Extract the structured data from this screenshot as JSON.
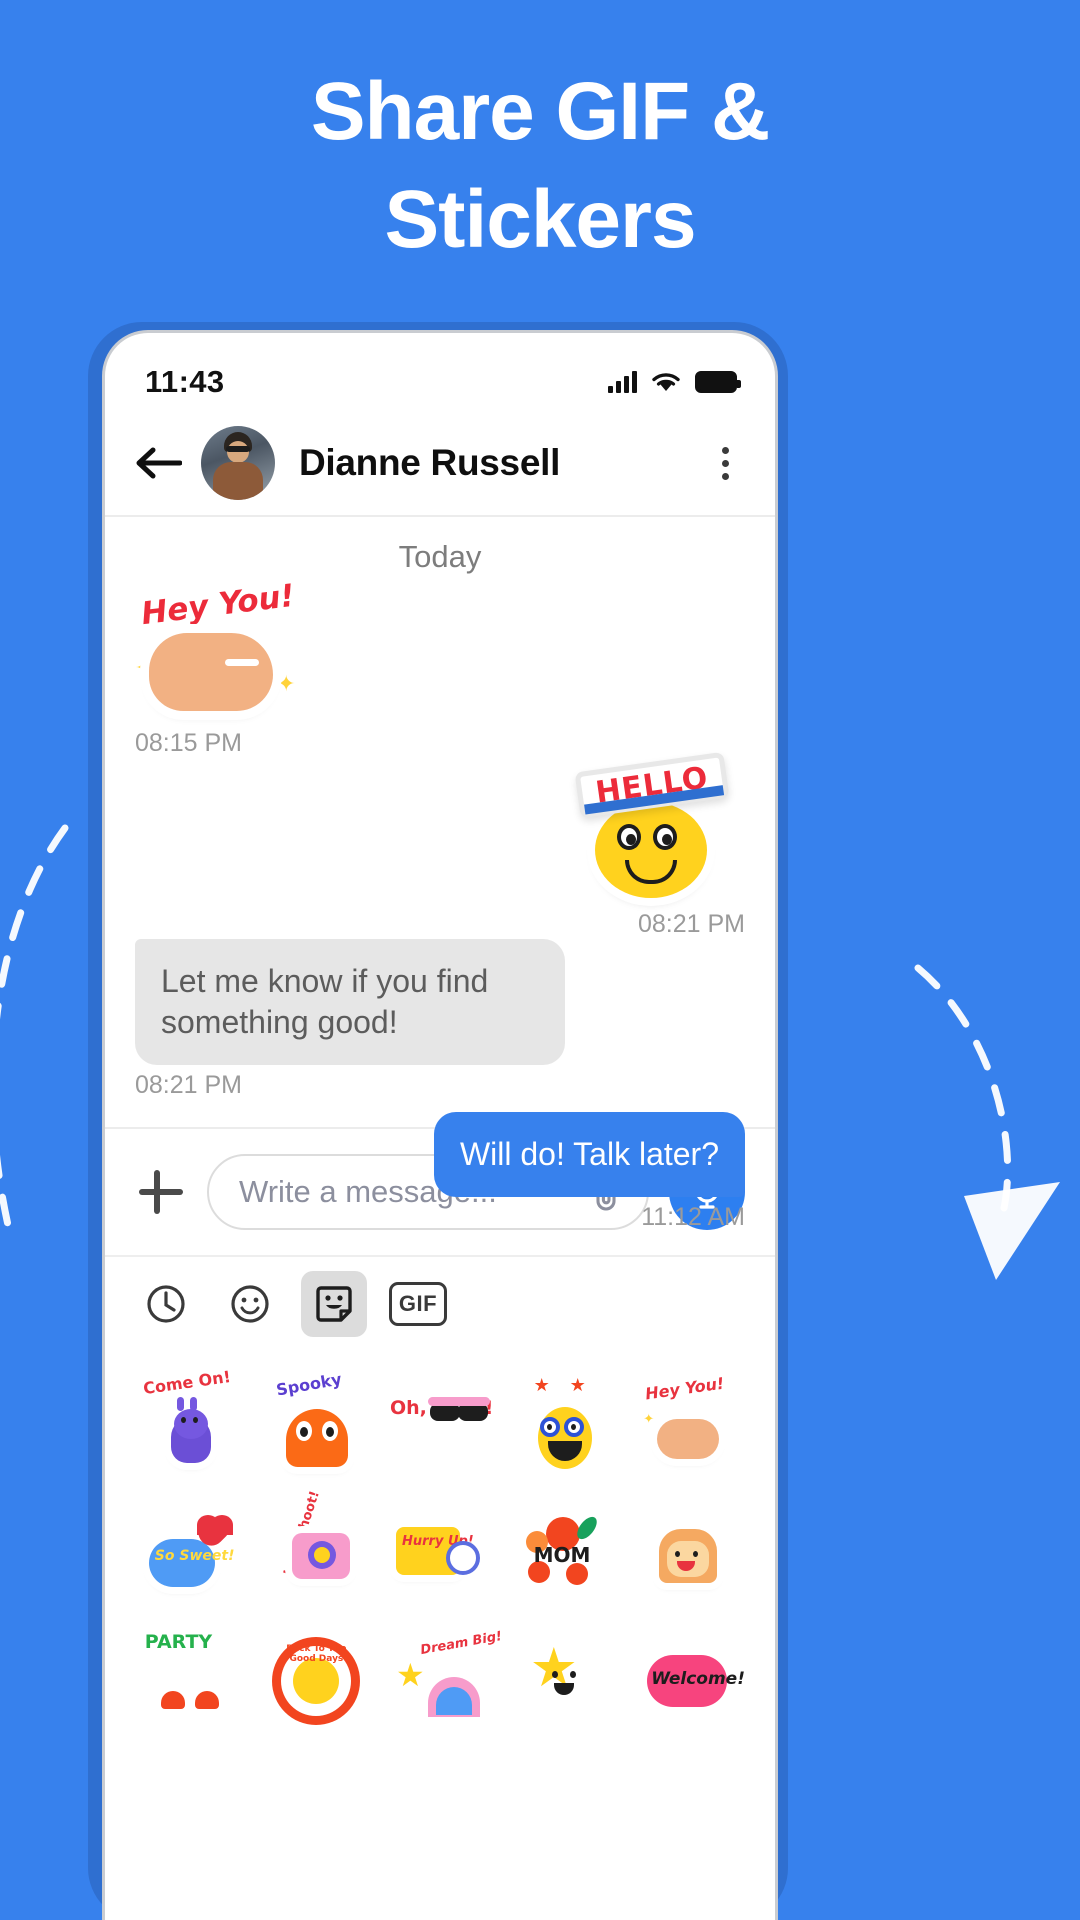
{
  "promo": {
    "headline_line1": "Share GIF &",
    "headline_line2": "Stickers",
    "background_color": "#3781ed"
  },
  "status_bar": {
    "time": "11:43",
    "icons": [
      "signal-icon",
      "wifi-icon",
      "battery-icon"
    ]
  },
  "chat_header": {
    "back_icon": "back-arrow-icon",
    "avatar": "contact-avatar",
    "contact_name": "Dianne Russell",
    "more_icon": "more-vertical-icon"
  },
  "conversation": {
    "day_separator": "Today",
    "messages": [
      {
        "type": "sticker",
        "direction": "in",
        "sticker_label": "Hey You!",
        "time": "08:15 PM"
      },
      {
        "type": "sticker",
        "direction": "out",
        "sticker_label": "HELLO",
        "time": "08:21 PM"
      },
      {
        "type": "text",
        "direction": "in",
        "text": "Let me know if you find something good!",
        "time": "08:21 PM"
      },
      {
        "type": "text",
        "direction": "out",
        "text": "Will do! Talk later?",
        "time": "11:12 AM"
      }
    ]
  },
  "input_bar": {
    "add_icon": "plus-icon",
    "placeholder": "Write a message...",
    "value": "",
    "attach_icon": "paperclip-icon",
    "mic_icon": "microphone-icon",
    "mic_color": "#2d7ff0"
  },
  "sticker_tray": {
    "tabs": [
      {
        "id": "recent",
        "icon": "clock-icon",
        "active": false
      },
      {
        "id": "emoji",
        "icon": "smiley-icon",
        "active": false
      },
      {
        "id": "sticker",
        "icon": "sticker-icon",
        "active": true
      },
      {
        "id": "gif",
        "icon": "gif-icon",
        "label": "GIF",
        "active": false
      }
    ],
    "stickers": [
      {
        "label": "Come On!",
        "name": "sticker-come-on"
      },
      {
        "label": "Spooky",
        "name": "sticker-spooky"
      },
      {
        "label": "Oh, Yeah!",
        "name": "sticker-oh-yeah"
      },
      {
        "label": "",
        "name": "sticker-nerd-face"
      },
      {
        "label": "Hey You!",
        "name": "sticker-hey-you"
      },
      {
        "label": "So Sweet!",
        "name": "sticker-so-sweet"
      },
      {
        "label": "Let's Shoot!",
        "name": "sticker-lets-shoot"
      },
      {
        "label": "Hurry Up!",
        "name": "sticker-hurry-up"
      },
      {
        "label": "MOM",
        "name": "sticker-mom"
      },
      {
        "label": "",
        "name": "sticker-toast"
      },
      {
        "label": "PARTY",
        "name": "sticker-party"
      },
      {
        "label": "Back To The Good Days",
        "name": "sticker-good-days"
      },
      {
        "label": "Dream Big!",
        "name": "sticker-dream-big"
      },
      {
        "label": "",
        "name": "sticker-star"
      },
      {
        "label": "Welcome!",
        "name": "sticker-welcome"
      }
    ]
  },
  "colors": {
    "brand_blue": "#3781ed",
    "bubble_out": "#3781ed",
    "bubble_in": "#e6e6e6",
    "timestamp": "#9a9a9a"
  }
}
